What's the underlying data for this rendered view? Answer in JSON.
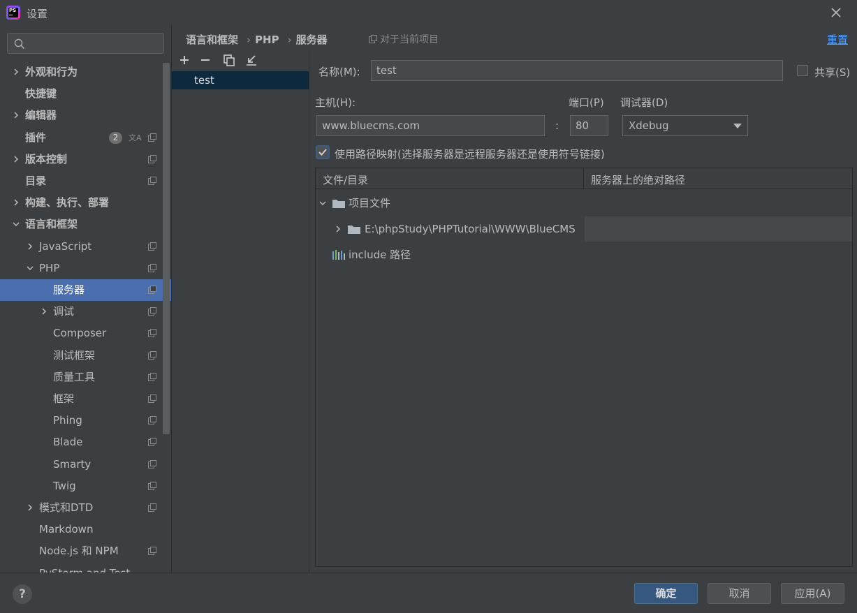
{
  "window": {
    "title": "设置"
  },
  "search": {
    "placeholder": ""
  },
  "tree": [
    {
      "label": "外观和行为",
      "bold": true,
      "expandable": true,
      "expanded": false,
      "level": 0
    },
    {
      "label": "快捷键",
      "bold": true,
      "expandable": false,
      "level": 0
    },
    {
      "label": "编辑器",
      "bold": true,
      "expandable": true,
      "expanded": false,
      "level": 0
    },
    {
      "label": "插件",
      "bold": true,
      "expandable": false,
      "level": 0,
      "badge": "2"
    },
    {
      "label": "版本控制",
      "bold": true,
      "expandable": true,
      "expanded": false,
      "level": 0
    },
    {
      "label": "目录",
      "bold": true,
      "expandable": false,
      "level": 0
    },
    {
      "label": "构建、执行、部署",
      "bold": true,
      "expandable": true,
      "expanded": false,
      "level": 0
    },
    {
      "label": "语言和框架",
      "bold": true,
      "expandable": true,
      "expanded": true,
      "level": 0
    },
    {
      "label": "JavaScript",
      "expandable": true,
      "expanded": false,
      "level": 1
    },
    {
      "label": "PHP",
      "expandable": true,
      "expanded": true,
      "level": 1
    },
    {
      "label": "服务器",
      "expandable": false,
      "level": 2,
      "selected": true
    },
    {
      "label": "调试",
      "expandable": true,
      "expanded": false,
      "level": 2
    },
    {
      "label": "Composer",
      "expandable": false,
      "level": 2
    },
    {
      "label": "测试框架",
      "expandable": false,
      "level": 2
    },
    {
      "label": "质量工具",
      "expandable": false,
      "level": 2
    },
    {
      "label": "框架",
      "expandable": false,
      "level": 2
    },
    {
      "label": "Phing",
      "expandable": false,
      "level": 2
    },
    {
      "label": "Blade",
      "expandable": false,
      "level": 2
    },
    {
      "label": "Smarty",
      "expandable": false,
      "level": 2
    },
    {
      "label": "Twig",
      "expandable": false,
      "level": 2
    },
    {
      "label": "模式和DTD",
      "expandable": true,
      "expanded": false,
      "level": 1
    },
    {
      "label": "Markdown",
      "expandable": false,
      "level": 1
    },
    {
      "label": "Node.js 和 NPM",
      "expandable": false,
      "level": 1
    },
    {
      "label": "PyStorm and Test",
      "expandable": false,
      "level": 1
    }
  ],
  "breadcrumb": [
    "语言和框架",
    "PHP",
    "服务器"
  ],
  "scope_note": "对于当前项目",
  "reset_label": "重置",
  "servers": {
    "items": [
      "test"
    ],
    "selected": "test"
  },
  "form": {
    "name_label": "名称(M):",
    "name_value": "test",
    "share_label": "共享(S)",
    "share_checked": false,
    "host_label": "主机(H):",
    "host_value": "www.bluecms.com",
    "port_label": "端口(P)",
    "port_value": "80",
    "debugger_label": "调试器(D)",
    "debugger_value": "Xdebug",
    "colon": ":",
    "use_path_mapping_label": "使用路径映射(选择服务器是远程服务器还是使用符号链接)",
    "use_path_mapping_checked": true
  },
  "mapping": {
    "col_local": "文件/目录",
    "col_remote": "服务器上的绝对路径",
    "project_files": "项目文件",
    "project_path": "E:\\phpStudy\\PHPTutorial\\WWW\\BlueCMS",
    "remote_path": "",
    "include_paths": "include 路径"
  },
  "buttons": {
    "ok": "确定",
    "cancel": "取消",
    "apply": "应用(A)",
    "help": "?"
  },
  "colors": {
    "selection": "#4b6eaf",
    "link": "#589df6",
    "primary_button": "#365880"
  }
}
